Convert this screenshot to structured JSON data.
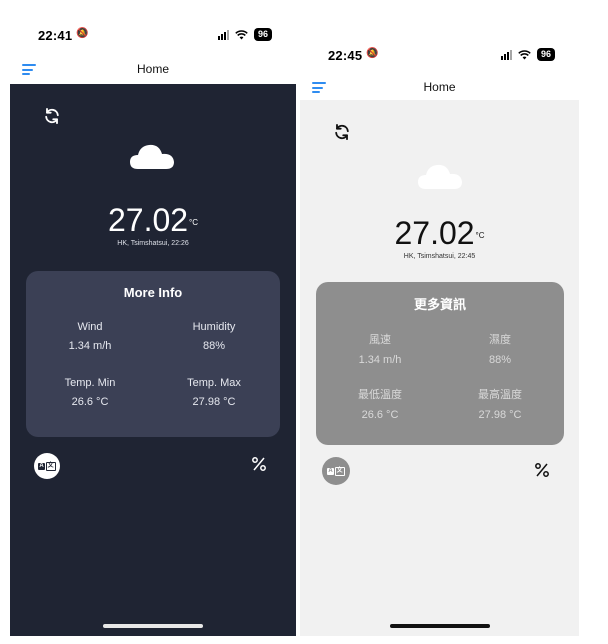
{
  "screens": [
    {
      "theme": "dark",
      "status_bar": {
        "time": "22:41",
        "battery": "96"
      },
      "app_bar": {
        "title": "Home"
      },
      "weather": {
        "icon": "cloud-icon",
        "temperature": "27.02",
        "unit": "°C",
        "location": "HK, Tsimshatsui, 22:26"
      },
      "more_info": {
        "title": "More Info",
        "wind_label": "Wind",
        "wind_value": "1.34 m/h",
        "humidity_label": "Humidity",
        "humidity_value": "88%",
        "temp_min_label": "Temp. Min",
        "temp_min_value": "26.6 °C",
        "temp_max_label": "Temp. Max",
        "temp_max_value": "27.98 °C"
      },
      "colors": {
        "background": "#1f2433",
        "card": "#3b4055",
        "accent": "#2f8cf0"
      }
    },
    {
      "theme": "light",
      "status_bar": {
        "time": "22:45",
        "battery": "96"
      },
      "app_bar": {
        "title": "Home"
      },
      "weather": {
        "icon": "cloud-icon",
        "temperature": "27.02",
        "unit": "°C",
        "location": "HK, Tsimshatsui, 22:45"
      },
      "more_info": {
        "title": "更多資訊",
        "wind_label": "風速",
        "wind_value": "1.34 m/h",
        "humidity_label": "濕度",
        "humidity_value": "88%",
        "temp_min_label": "最低溫度",
        "temp_min_value": "26.6 °C",
        "temp_max_label": "最高溫度",
        "temp_max_value": "27.98 °C"
      },
      "colors": {
        "background": "#f1f1f1",
        "card": "#8e8e8e",
        "accent": "#2f8cf0"
      }
    }
  ]
}
